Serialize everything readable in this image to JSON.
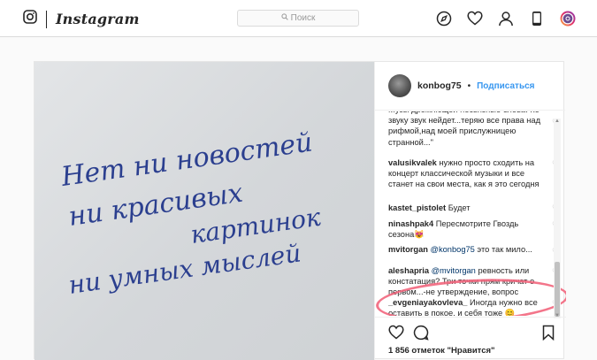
{
  "header": {
    "brand": "Instagram",
    "search_placeholder": "Поиск",
    "icons": [
      "explore-icon",
      "heart-icon",
      "profile-icon",
      "phone-icon",
      "camera-avatar-icon"
    ]
  },
  "photo": {
    "handwritten_lines": [
      "Нет ни новостей",
      "ни красивых",
      "картинок",
      "ни умных мыслей"
    ]
  },
  "post": {
    "author": "konbog75",
    "separator": "•",
    "follow_label": "Подписаться",
    "likes_text": "1 856 отметок \"Нравится\""
  },
  "comments": [
    {
      "user": "",
      "text": "Музы дремлющей несвязные слова. Ко звуку звук нейдет...теряю все права над рифмой,над моей прислужницею странной...\""
    },
    {
      "user": "valusikvalek",
      "text": "нужно просто сходить на концерт классической музыки и все станет на свои места, как я это сегодня"
    },
    {
      "user": "kastet_pistolet",
      "text": "Будет"
    },
    {
      "user": "ninashpak4",
      "text": "Пересмотрите Гвоздь сезона😻"
    },
    {
      "user": "mvitorgan",
      "mention": "@konbog75",
      "text": "это так мило..."
    },
    {
      "user": "aleshapria",
      "mention": "@mvitorgan",
      "text": "ревность или констатация? Три точки прям кричат о первом...-не утверждение, вопрос"
    },
    {
      "user": "_evgeniayakovleva_",
      "text": "Иногда нужно все оставить в покое, и себя тоже 😊"
    }
  ],
  "colors": {
    "accent": "#3897f0",
    "highlight_circle": "#f2667d",
    "ink": "#2b3f8f"
  }
}
